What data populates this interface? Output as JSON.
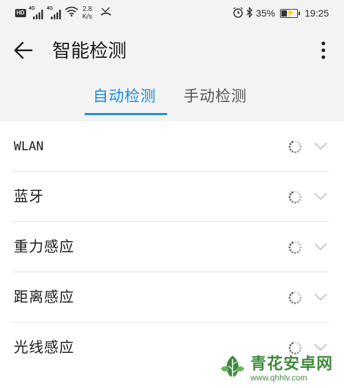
{
  "status_bar": {
    "hd_badge": "HD",
    "signal1_gen": "4G",
    "signal2_gen": "4G",
    "speed_value": "2.8",
    "speed_unit": "K/s",
    "battery_percent": "35%",
    "battery_level": 0.35,
    "time": "19:25"
  },
  "toolbar": {
    "title": "智能检测",
    "back_icon": "arrow-left-icon",
    "more_icon": "more-vertical-icon"
  },
  "tabs": [
    {
      "label": "自动检测",
      "active": true
    },
    {
      "label": "手动检测",
      "active": false
    }
  ],
  "items": [
    {
      "label": "WLAN"
    },
    {
      "label": "蓝牙"
    },
    {
      "label": "重力感应"
    },
    {
      "label": "距离感应"
    },
    {
      "label": "光线感应"
    }
  ],
  "watermark": {
    "name": "青花安卓网",
    "url": "www.qhhlv.com"
  },
  "colors": {
    "accent": "#1a8cd8",
    "header_bg": "#f3f3f3",
    "watermark_green": "#3e8a3a"
  }
}
